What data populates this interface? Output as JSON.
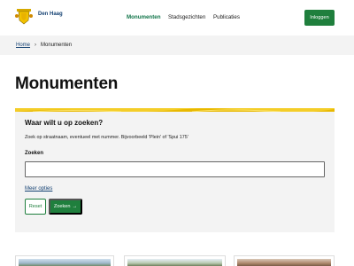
{
  "header": {
    "logo_text": "Den Haag",
    "nav": [
      "Monumenten",
      "Stadsgezichten",
      "Publicaties"
    ],
    "login_label": "Inloggen"
  },
  "breadcrumb": {
    "home": "Home",
    "separator": "›",
    "current": "Monumenten"
  },
  "page": {
    "title": "Monumenten"
  },
  "search": {
    "heading": "Waar wilt u op zoeken?",
    "hint": "Zoek op straatnaam, eventueel met nummer. Bijvoorbeeld 'Plein' of 'Spui 175'",
    "field_label": "Zoeken",
    "field_value": "",
    "more_options": "Meer opties",
    "reset_label": "Reset",
    "submit_label": "Zoeken",
    "submit_arrow": "→"
  },
  "colors": {
    "accent_green": "#1f7f3d",
    "link_blue": "#154273",
    "banner_yellow": "#f4cd28",
    "panel_grey": "#f3f3f3"
  },
  "icons": {
    "logo": "den-haag-crest-icon",
    "breadcrumb_sep": "chevron-right-icon",
    "submit": "arrow-right-icon"
  }
}
